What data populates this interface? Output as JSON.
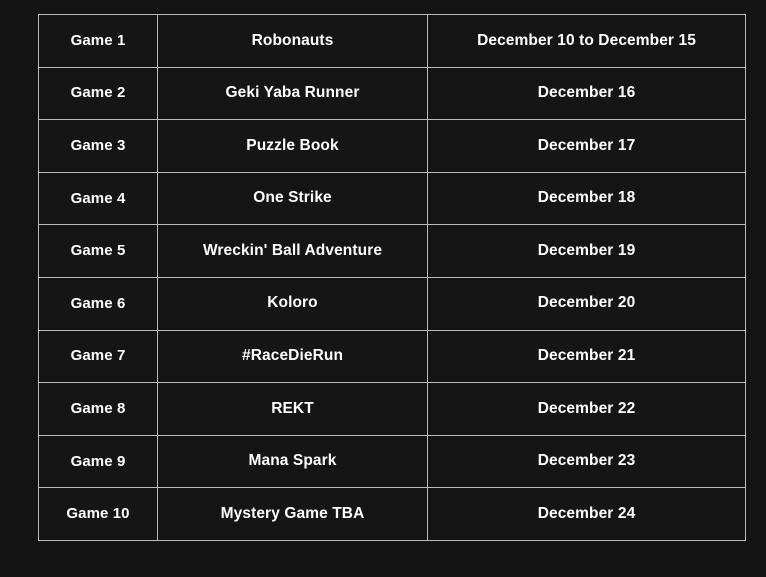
{
  "theme": {
    "page_background": "#141414",
    "cell_background": "#151515",
    "border_color": "#b9b9b9",
    "text_color": "#ffffff"
  },
  "table": {
    "columns": [
      "slot",
      "title",
      "date"
    ],
    "rows": [
      {
        "slot": "Game 1",
        "title": "Robonauts",
        "date": "December 10 to December 15"
      },
      {
        "slot": "Game 2",
        "title": "Geki Yaba Runner",
        "date": "December 16"
      },
      {
        "slot": "Game 3",
        "title": "Puzzle Book",
        "date": "December 17"
      },
      {
        "slot": "Game 4",
        "title": "One Strike",
        "date": "December 18"
      },
      {
        "slot": "Game 5",
        "title": "Wreckin' Ball Adventure",
        "date": "December 19"
      },
      {
        "slot": "Game 6",
        "title": "Koloro",
        "date": "December 20"
      },
      {
        "slot": "Game 7",
        "title": "#RaceDieRun",
        "date": "December 21"
      },
      {
        "slot": "Game 8",
        "title": "REKT",
        "date": "December 22"
      },
      {
        "slot": "Game 9",
        "title": "Mana Spark",
        "date": "December 23"
      },
      {
        "slot": "Game 10",
        "title": "Mystery Game TBA",
        "date": "December 24"
      }
    ]
  }
}
